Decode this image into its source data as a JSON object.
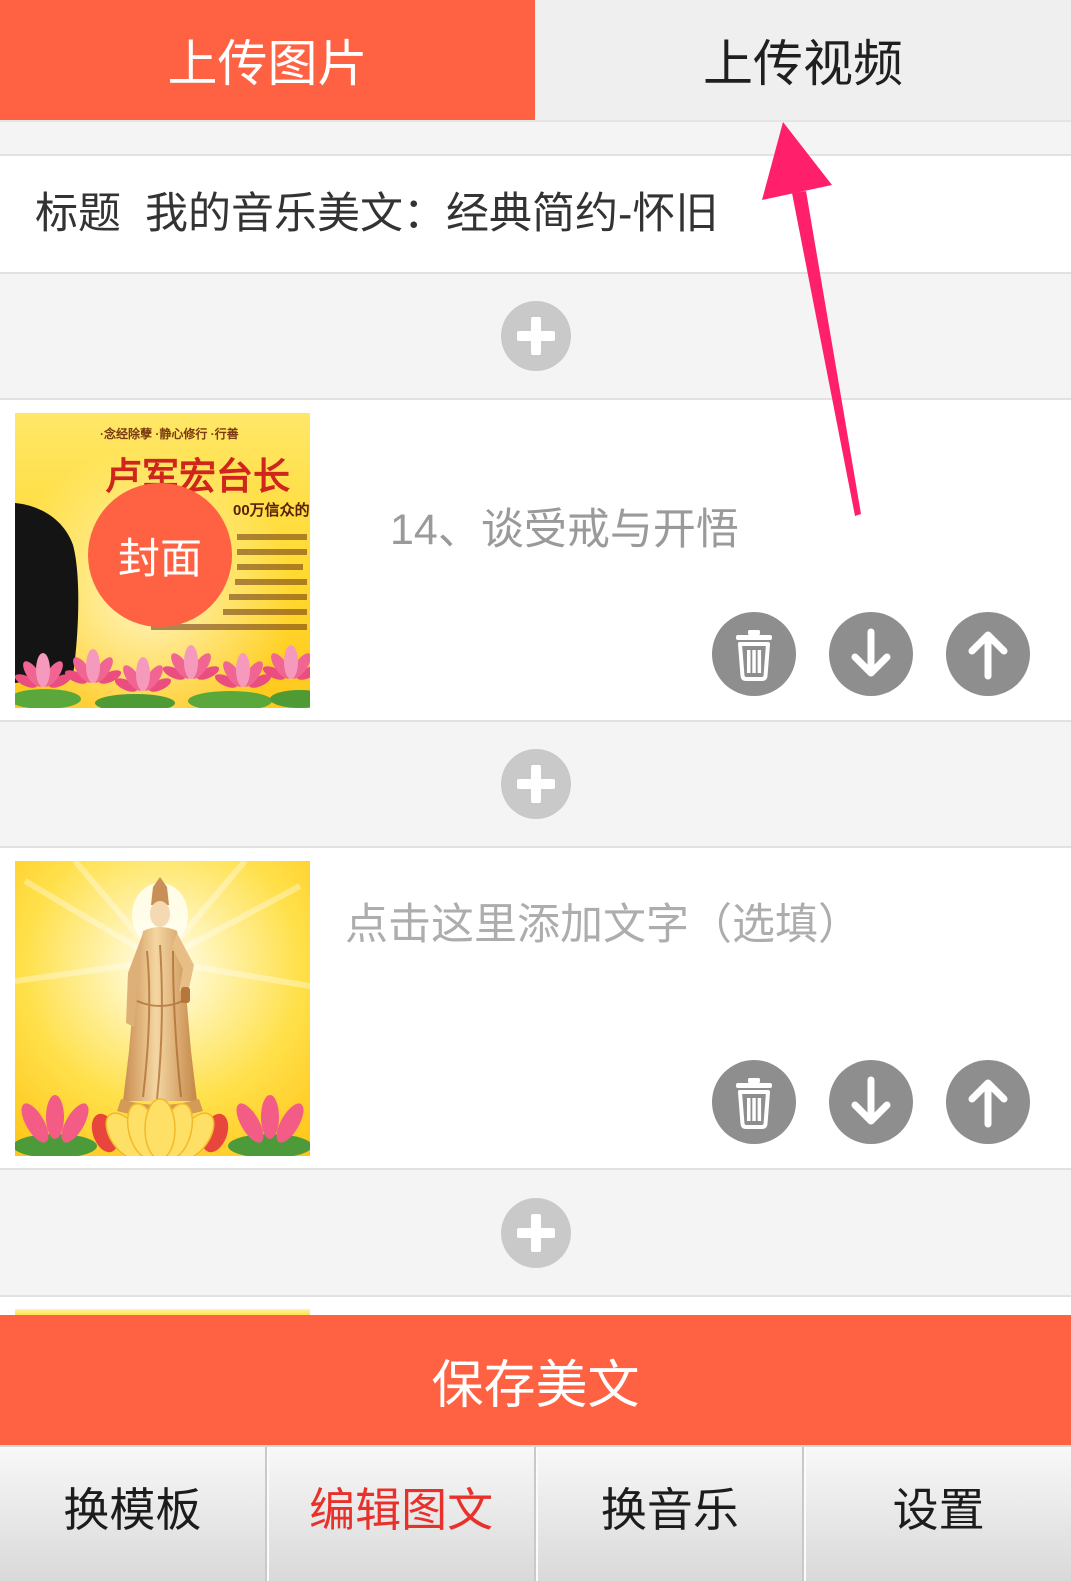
{
  "tabs": {
    "upload_image": {
      "label": "上传图片",
      "active": true
    },
    "upload_video": {
      "label": "上传视频",
      "active": false
    }
  },
  "title_field": {
    "label": "标题",
    "value": "我的音乐美文：经典简约-怀旧"
  },
  "add_row_icon": "plus-icon",
  "items": [
    {
      "text": "14、谈受戒与开悟",
      "cover_badge": "封面",
      "image_text": {
        "tagline": "·念经除孽  ·静心修行  ·行善",
        "headline": "卢军宏台长",
        "subline": "00万信众的"
      }
    },
    {
      "placeholder": "点击这里添加文字（选填）"
    }
  ],
  "item_action_icons": {
    "delete": "trash-icon",
    "move_down": "arrow-down-icon",
    "move_up": "arrow-up-icon"
  },
  "save_button": {
    "label": "保存美文"
  },
  "bottom_nav": [
    {
      "label": "换模板",
      "active": false
    },
    {
      "label": "编辑图文",
      "active": true
    },
    {
      "label": "换音乐",
      "active": false
    },
    {
      "label": "设置",
      "active": false
    }
  ],
  "colors": {
    "accent": "#FF6243",
    "active_nav_text": "#E8312B",
    "action_button": "#8E8E8E",
    "add_button": "#C9C9C9",
    "annotation_arrow": "#FF1F6B"
  }
}
